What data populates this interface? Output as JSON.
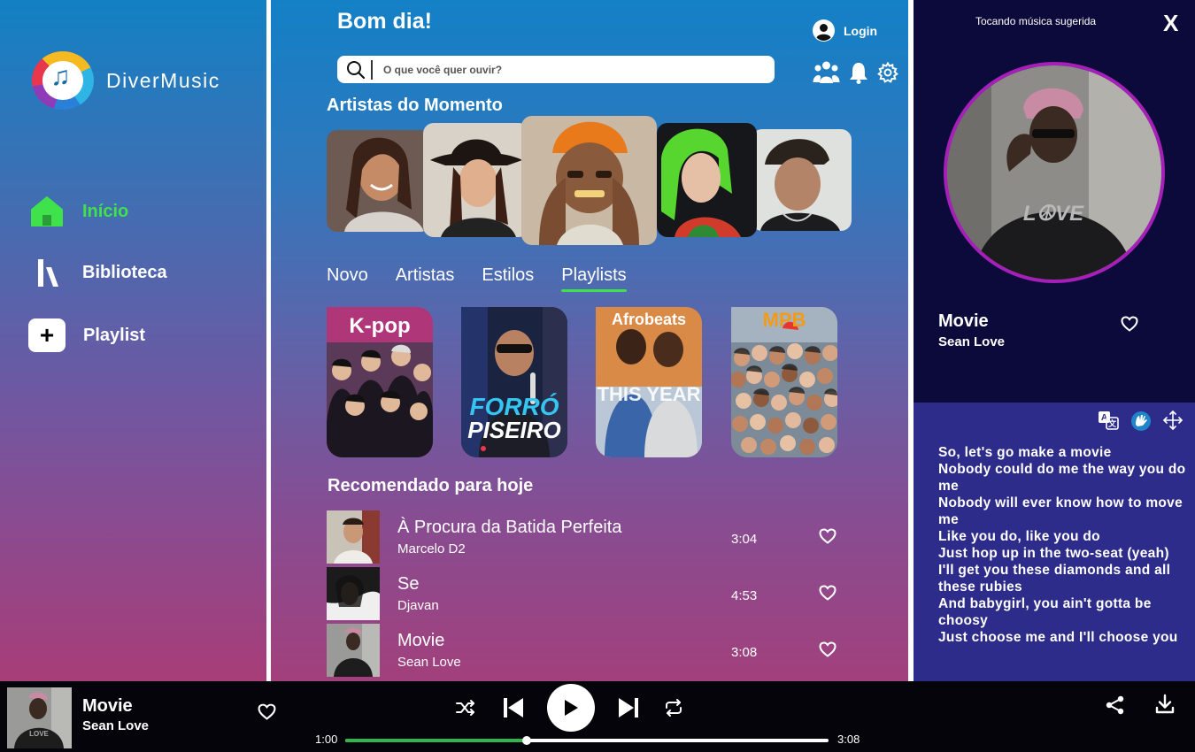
{
  "app": {
    "name": "DiverMusic"
  },
  "sidebar": {
    "items": [
      {
        "label": "Início",
        "icon": "home-icon",
        "active": true
      },
      {
        "label": "Biblioteca",
        "icon": "library-icon",
        "active": false
      },
      {
        "label": "Playlist",
        "icon": "plus-icon",
        "active": false
      }
    ]
  },
  "header": {
    "greeting": "Bom dia!",
    "login_label": "Login",
    "search_placeholder": "O que você quer ouvir?"
  },
  "artists_section": {
    "title": "Artistas do Momento"
  },
  "tabs": [
    {
      "label": "Novo",
      "active": false
    },
    {
      "label": "Artistas",
      "active": false
    },
    {
      "label": "Estilos",
      "active": false
    },
    {
      "label": "Playlists",
      "active": true
    }
  ],
  "playlists": [
    {
      "title": "K-pop",
      "title_color": "#ffffff"
    },
    {
      "title": "",
      "title_color": "#ffffff"
    },
    {
      "title": "Afrobeats",
      "title_color": "#ffffff"
    },
    {
      "title": "MPB",
      "title_color": "#f39b16"
    }
  ],
  "recommended": {
    "title": "Recomendado para hoje",
    "songs": [
      {
        "title": "À Procura da Batida Perfeita",
        "artist": "Marcelo D2",
        "duration": "3:04"
      },
      {
        "title": "Se",
        "artist": "Djavan",
        "duration": "4:53"
      },
      {
        "title": "Movie",
        "artist": "Sean Love",
        "duration": "3:08"
      }
    ]
  },
  "now_playing_panel": {
    "label": "Tocando música sugerida",
    "close": "X",
    "title": "Movie",
    "artist": "Sean Love",
    "lyrics": [
      "So, let's go make a movie",
      "Nobody could do me the way you do me",
      "Nobody will ever know how to move me",
      "Like you do, like you do",
      "Just hop up in the two-seat (yeah)",
      "I'll get you these diamonds and all these rubies",
      "And babygirl, you ain't gotta be choosy",
      "Just choose me and I'll choose you"
    ]
  },
  "player": {
    "title": "Movie",
    "artist": "Sean Love",
    "current_time": "1:00",
    "total_time": "3:08",
    "progress": 0.375
  },
  "colors": {
    "accent_green": "#3fe24a",
    "progress_green": "#2eb84a",
    "panel_dark": "#0c0a3a",
    "lyrics_bg": "#2e2c8a",
    "cover_ring": "#a61fb8"
  }
}
